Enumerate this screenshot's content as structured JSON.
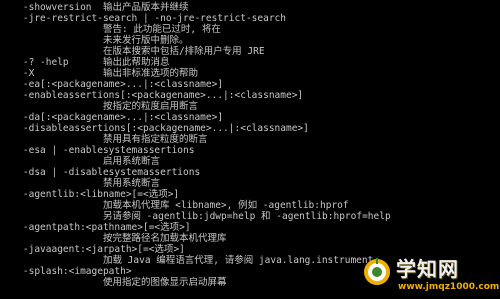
{
  "console": {
    "lines": [
      "    -showversion  输出产品版本并继续",
      "    -jre-restrict-search | -no-jre-restrict-search",
      "                  警告: 此功能已过时, 将在",
      "                  未来发行版中删除。",
      "                  在版本搜索中包括/排除用户专用 JRE",
      "    -? -help      输出此帮助消息",
      "    -X            输出非标准选项的帮助",
      "    -ea[:<packagename>...|:<classname>]",
      "    -enableassertions[:<packagename>...|:<classname>]",
      "                  按指定的粒度启用断言",
      "    -da[:<packagename>...|:<classname>]",
      "    -disableassertions[:<packagename>...|:<classname>]",
      "                  禁用具有指定粒度的断言",
      "    -esa | -enablesystemassertions",
      "                  启用系统断言",
      "    -dsa | -disablesystemassertions",
      "                  禁用系统断言",
      "    -agentlib:<libname>[=<选项>]",
      "                  加载本机代理库 <libname>, 例如 -agentlib:hprof",
      "                  另请参阅 -agentlib:jdwp=help 和 -agentlib:hprof=help",
      "    -agentpath:<pathname>[=<选项>]",
      "                  按完整路径名加载本机代理库",
      "    -javaagent:<jarpath>[=<选项>]",
      "                  加载 Java 编程语言代理, 请参阅 java.lang.instrument",
      "    -splash:<imagepath>",
      "                  使用指定的图像显示启动屏幕"
    ]
  },
  "watermark": {
    "title": "学知网",
    "url": "www.jmqz1000.com",
    "accent_color": "#f0b000"
  }
}
